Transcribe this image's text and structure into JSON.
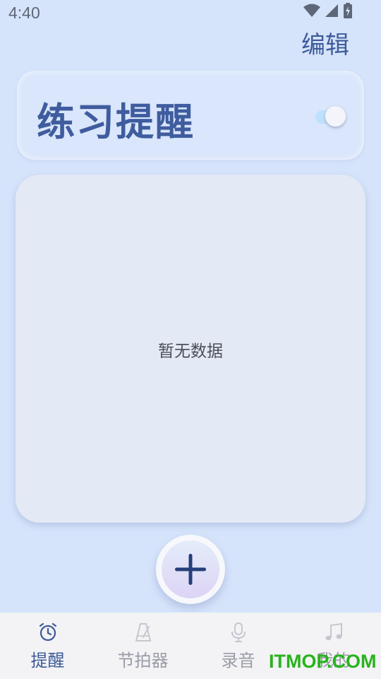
{
  "status_bar": {
    "time": "4:40",
    "icons": [
      "wifi-icon",
      "cell-signal-icon",
      "battery-charging-icon"
    ]
  },
  "header": {
    "edit_label": "编辑"
  },
  "reminder": {
    "title": "练习提醒",
    "toggle_on": true
  },
  "list": {
    "empty_text": "暂无数据"
  },
  "fab": {
    "icon": "plus-icon"
  },
  "tab_bar": {
    "tabs": [
      {
        "label": "提醒",
        "icon": "alarm-clock-icon",
        "active": true
      },
      {
        "label": "节拍器",
        "icon": "metronome-icon",
        "active": false
      },
      {
        "label": "录音",
        "icon": "microphone-icon",
        "active": false
      },
      {
        "label": "我的",
        "icon": "music-note-icon",
        "active": false
      }
    ]
  },
  "watermark": {
    "text": "ITMOP.COM"
  },
  "colors": {
    "background": "#d6e4fb",
    "accent": "#3d5a99",
    "panel": "#e3e9f5",
    "tab_inactive": "#9a9ca6",
    "watermark": "#28b31e"
  }
}
